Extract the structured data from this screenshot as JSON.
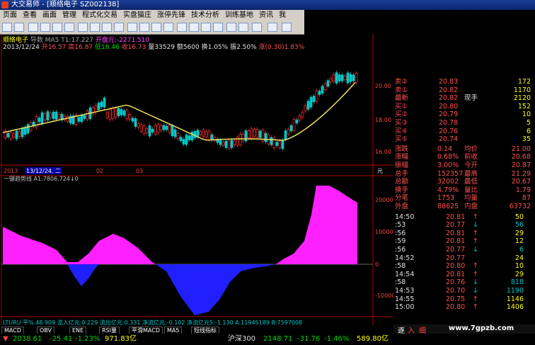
{
  "window": {
    "title": "大交易师 - [顺络电子 SZ002138]",
    "controls": [
      "_",
      "□",
      "×"
    ]
  },
  "menu": [
    "页面",
    "查看",
    "画面",
    "管理",
    "程式化交易",
    "实盘猫庄",
    "涨停先锋",
    "技术分析",
    "训练基地",
    "资讯",
    "我"
  ],
  "info_line1": {
    "name": "顺络电子",
    "indicator": "导数 MA5 T1:17.227",
    "extra": "开盘元:-2271.510"
  },
  "info_line2": {
    "date": "2013/12/24",
    "open": "开16.57",
    "high": "高16.87",
    "low": "低16.46",
    "close": "收16.73",
    "vol": "量33529",
    "amount": "额5600",
    "turnover": "换1.05%",
    "amp": "振2.50%",
    "chg": "涨(0.30)1.83%"
  },
  "price_axis": [
    "20.00",
    "18.00",
    "16.00"
  ],
  "time_axis": [
    "2013",
    "13/12/24, 二",
    "02",
    "03"
  ],
  "indicator_label": "一键趋势线 A1:7806.724↓0",
  "indicator_axis": [
    "20000",
    "10000",
    "0",
    "-10000"
  ],
  "unit_label": "元",
  "bottom_info": "LTURU  平%.48.909  流入亿元:0.229  流出亿元:0.331  净流亿元:-0.102  净流亿元5:-1.130  A:11945189  B:7597008",
  "bottom_tabs": [
    "MACD",
    "OBV",
    "ENE",
    "RSI量",
    "平滑MACD",
    "MA5",
    "短线指标"
  ],
  "order_book": [
    {
      "label": "卖②",
      "price": "20.83",
      "vol": "172"
    },
    {
      "label": "卖①",
      "price": "20.82",
      "vol": "1170"
    },
    {
      "label": "最新",
      "price": "20.82",
      "label2": "现手",
      "vol": "2120"
    },
    {
      "label": "买①",
      "price": "20.80",
      "vol": "152"
    },
    {
      "label": "买②",
      "price": "20.79",
      "vol": "10"
    },
    {
      "label": "买③",
      "price": "20.78",
      "vol": "5"
    },
    {
      "label": "买④",
      "price": "20.76",
      "vol": "6"
    },
    {
      "label": "买⑤",
      "price": "20.74",
      "vol": "35"
    }
  ],
  "stats": [
    {
      "l1": "涨跌",
      "v1": "0.14",
      "l2": "均价",
      "v2": "21.00"
    },
    {
      "l1": "涨幅",
      "v1": "0.68%",
      "l2": "前收",
      "v2": "20.68"
    },
    {
      "l1": "振幅",
      "v1": "3.00%",
      "l2": "今开",
      "v2": "20.87"
    },
    {
      "l1": "总手",
      "v1": "152357",
      "l2": "最高",
      "v2": "21.29"
    },
    {
      "l1": "总额",
      "v1": "32002",
      "l2": "最低",
      "v2": "20.67"
    },
    {
      "l1": "换手",
      "v1": "4.79%",
      "l2": "量比",
      "v2": "1.79"
    },
    {
      "l1": "分笔",
      "v1": "1753",
      "l2": "均量",
      "v2": "87"
    },
    {
      "l1": "外盘",
      "v1": "88625",
      "l2": "内盘",
      "v2": "63732"
    }
  ],
  "ticks": [
    {
      "t": "14:50",
      "p": "20.81",
      "a": "↑",
      "v": "50"
    },
    {
      "t": ":53",
      "p": "20.77",
      "a": "↓",
      "v": "56"
    },
    {
      "t": ":56",
      "p": "20.81",
      "a": "↑",
      "v": "29"
    },
    {
      "t": ":59",
      "p": "20.81",
      "a": "↑",
      "v": "12"
    },
    {
      "t": ":56",
      "p": "20.77",
      "a": "↓",
      "v": "6"
    },
    {
      "t": "14:52",
      "p": "20.77",
      "a": "",
      "v": "24"
    },
    {
      "t": ":58",
      "p": "20.80",
      "a": "↑",
      "v": "10"
    },
    {
      "t": "14:54",
      "p": "20.81",
      "a": "↑",
      "v": "29"
    },
    {
      "t": ":58",
      "p": "20.76",
      "a": "↓",
      "v": "818"
    },
    {
      "t": "14:53",
      "p": "20.70",
      "a": "↓",
      "v": "1190"
    },
    {
      "t": "14:55",
      "p": "20.75",
      "a": "↑",
      "v": "1146"
    },
    {
      "t": "15:00",
      "p": "20.80",
      "a": "↑",
      "v": "1406"
    }
  ],
  "quote_tabs": [
    "逐",
    "入",
    "细"
  ],
  "watermark": "www.7gpzb.com",
  "index_bar": {
    "sh_label": "2038.61",
    "sh_chg": "-25.41",
    "sh_pct": "-1.23%",
    "sh_amt": "971.83亿",
    "hs300": "沪深300",
    "hs_val": "2148.71",
    "hs_chg": "-31.76",
    "hs_pct": "-1.46%",
    "hs_amt": "589.80亿"
  },
  "colors": {
    "up": "#ff3030",
    "down": "#00c8c8",
    "ma": "#f0e060",
    "pos_fill": "#ff20ff",
    "neg_fill": "#2020ff"
  }
}
